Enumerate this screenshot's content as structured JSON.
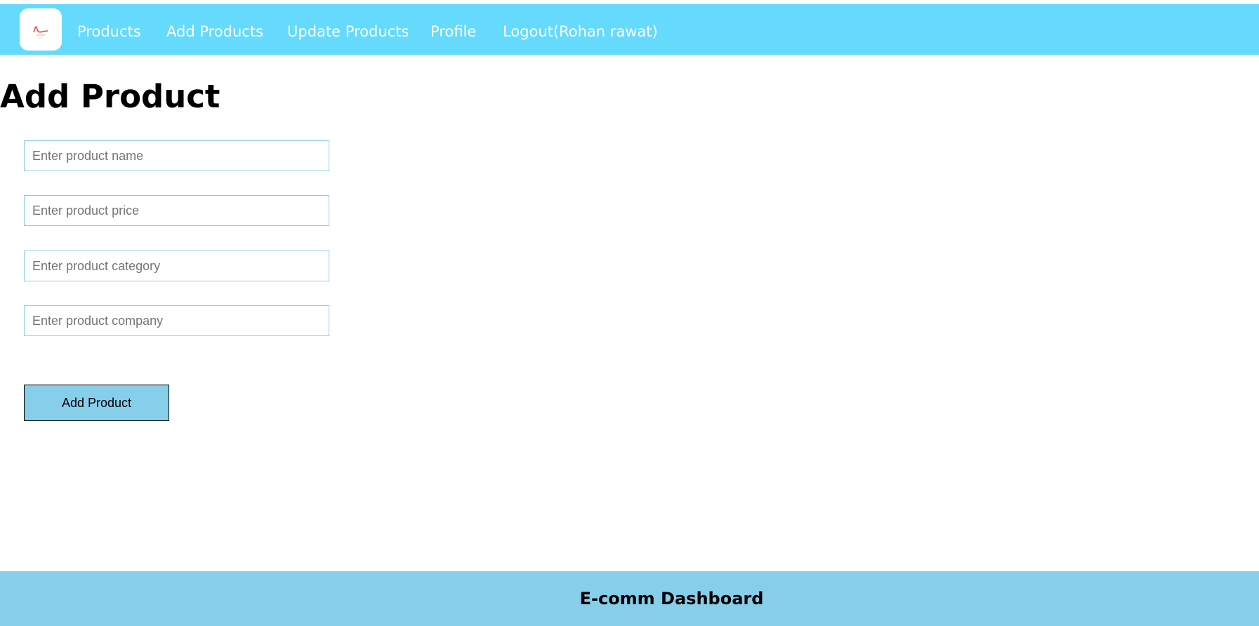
{
  "nav": {
    "items": [
      {
        "label": "Products"
      },
      {
        "label": "Add Products"
      },
      {
        "label": "Update Products"
      },
      {
        "label": "Profile"
      },
      {
        "label": "Logout(Rohan rawat)"
      }
    ],
    "logo_icon": "brand-logo-icon"
  },
  "page": {
    "title": "Add Product"
  },
  "form": {
    "name_placeholder": "Enter product name",
    "name_value": "",
    "price_placeholder": "Enter product price",
    "price_value": "",
    "category_placeholder": "Enter product category",
    "category_value": "",
    "company_placeholder": "Enter product company",
    "company_value": "",
    "submit_label": "Add Product"
  },
  "footer": {
    "text": "E-comm Dashboard"
  },
  "colors": {
    "navbar": "#65dafc",
    "footer": "#87ceeb",
    "button": "#87ceeb",
    "input_border": "#87ceeb"
  }
}
